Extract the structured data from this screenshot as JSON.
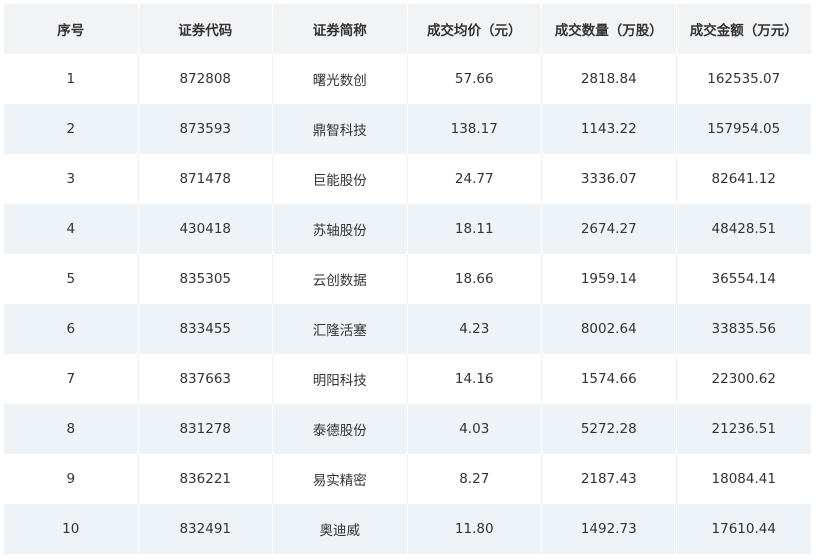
{
  "table": {
    "headers": [
      "序号",
      "证券代码",
      "证券简称",
      "成交均价（元）",
      "成交数量（万股）",
      "成交金额（万元）"
    ],
    "rows": [
      [
        "1",
        "872808",
        "曙光数创",
        "57.66",
        "2818.84",
        "162535.07"
      ],
      [
        "2",
        "873593",
        "鼎智科技",
        "138.17",
        "1143.22",
        "157954.05"
      ],
      [
        "3",
        "871478",
        "巨能股份",
        "24.77",
        "3336.07",
        "82641.12"
      ],
      [
        "4",
        "430418",
        "苏轴股份",
        "18.11",
        "2674.27",
        "48428.51"
      ],
      [
        "5",
        "835305",
        "云创数据",
        "18.66",
        "1959.14",
        "36554.14"
      ],
      [
        "6",
        "833455",
        "汇隆活塞",
        "4.23",
        "8002.64",
        "33835.56"
      ],
      [
        "7",
        "837663",
        "明阳科技",
        "14.16",
        "1574.66",
        "22300.62"
      ],
      [
        "8",
        "831278",
        "泰德股份",
        "4.03",
        "5272.28",
        "21236.51"
      ],
      [
        "9",
        "836221",
        "易实精密",
        "8.27",
        "2187.43",
        "18084.41"
      ],
      [
        "10",
        "832491",
        "奥迪威",
        "11.80",
        "1492.73",
        "17610.44"
      ]
    ]
  },
  "colors": {
    "header_bg": "#f2f3f5",
    "stripe_bg": "#eef3f7",
    "text": "#333333"
  }
}
